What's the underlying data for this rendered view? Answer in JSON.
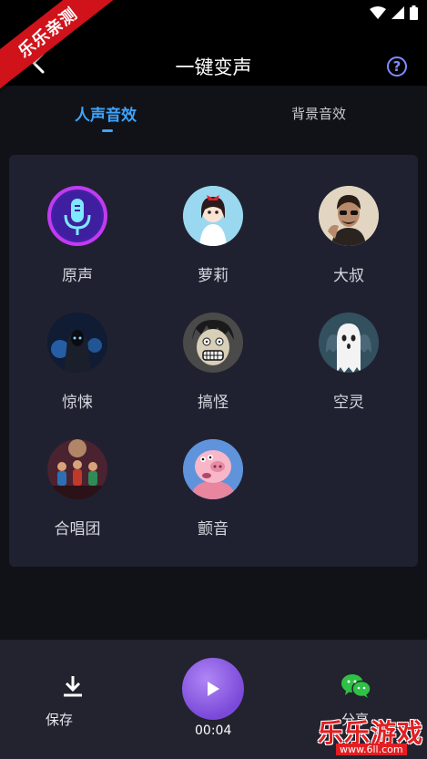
{
  "ribbon": {
    "text": "乐乐亲测"
  },
  "header": {
    "title": "一键变声",
    "help_glyph": "?"
  },
  "tabs": [
    {
      "label": "人声音效",
      "active": true
    },
    {
      "label": "背景音效",
      "active": false
    }
  ],
  "voices": [
    {
      "label": "原声",
      "icon": "microphone-icon"
    },
    {
      "label": "萝莉",
      "icon": "anime-girl-avatar"
    },
    {
      "label": "大叔",
      "icon": "man-with-sunglasses-avatar"
    },
    {
      "label": "惊悚",
      "icon": "dark-ghost-figure-avatar"
    },
    {
      "label": "搞怪",
      "icon": "screaming-face-avatar"
    },
    {
      "label": "空灵",
      "icon": "ghost-avatar"
    },
    {
      "label": "合唱团",
      "icon": "choir-band-avatar"
    },
    {
      "label": "颤音",
      "icon": "pig-avatar"
    }
  ],
  "bottom": {
    "save_label": "保存",
    "time": "00:04",
    "share_label": "分享"
  },
  "watermark": {
    "text": "乐乐游戏",
    "url": "www.6ll.com"
  },
  "colors": {
    "accent": "#3ea4ff",
    "panel": "#202130",
    "play": "#8b5ae6",
    "ribbon": "#d0121a",
    "wechat": "#2fc145"
  }
}
